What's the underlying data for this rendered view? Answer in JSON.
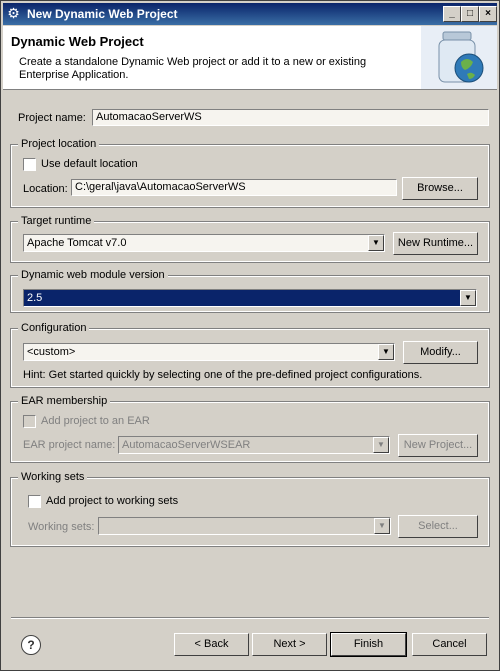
{
  "window": {
    "title": "New Dynamic Web Project",
    "controls": [
      "_",
      "□",
      "×"
    ]
  },
  "banner": {
    "title": "Dynamic Web Project",
    "description": "Create a standalone Dynamic Web project or add it to a new or existing Enterprise Application."
  },
  "project_name": {
    "label": "Project name:",
    "value": "AutomacaoServerWS"
  },
  "project_location": {
    "group": "Project location",
    "use_default": {
      "label": "Use default location",
      "checked": false
    },
    "location_label": "Location:",
    "location_value": "C:\\geral\\java\\AutomacaoServerWS",
    "browse": "Browse..."
  },
  "target_runtime": {
    "group": "Target runtime",
    "value": "Apache Tomcat v7.0",
    "new_runtime": "New Runtime..."
  },
  "module_version": {
    "group": "Dynamic web module version",
    "value": "2.5"
  },
  "configuration": {
    "group": "Configuration",
    "value": "<custom>",
    "modify": "Modify...",
    "hint": "Hint: Get started quickly by selecting one of the pre-defined project configurations."
  },
  "ear": {
    "group": "EAR membership",
    "add_label": "Add project to an EAR",
    "name_label": "EAR project name:",
    "name_value": "AutomacaoServerWSEAR",
    "new_project": "New Project..."
  },
  "working_sets": {
    "group": "Working sets",
    "add_label": "Add project to working sets",
    "sets_label": "Working sets:",
    "sets_value": "",
    "select": "Select..."
  },
  "footer": {
    "help": "?",
    "back": "< Back",
    "next": "Next >",
    "finish": "Finish",
    "cancel": "Cancel"
  }
}
